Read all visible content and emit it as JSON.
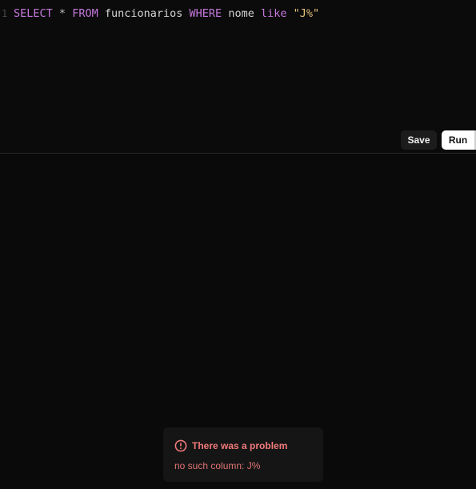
{
  "editor": {
    "line_number": "1",
    "tokens": {
      "t1": "SELECT",
      "t2": "*",
      "t3": "FROM",
      "t4": "funcionarios",
      "t5": "WHERE",
      "t6": "nome",
      "t7": "like",
      "t8": "\"J%\""
    }
  },
  "toolbar": {
    "save_label": "Save",
    "run_label": "Run"
  },
  "toast": {
    "icon": "alert-circle-icon",
    "title": "There was a problem",
    "message": "no such column: J%"
  },
  "colors": {
    "background": "#0a0a0a",
    "keyword": "#c678dd",
    "string": "#e5c07b",
    "error": "#f07a7a"
  }
}
